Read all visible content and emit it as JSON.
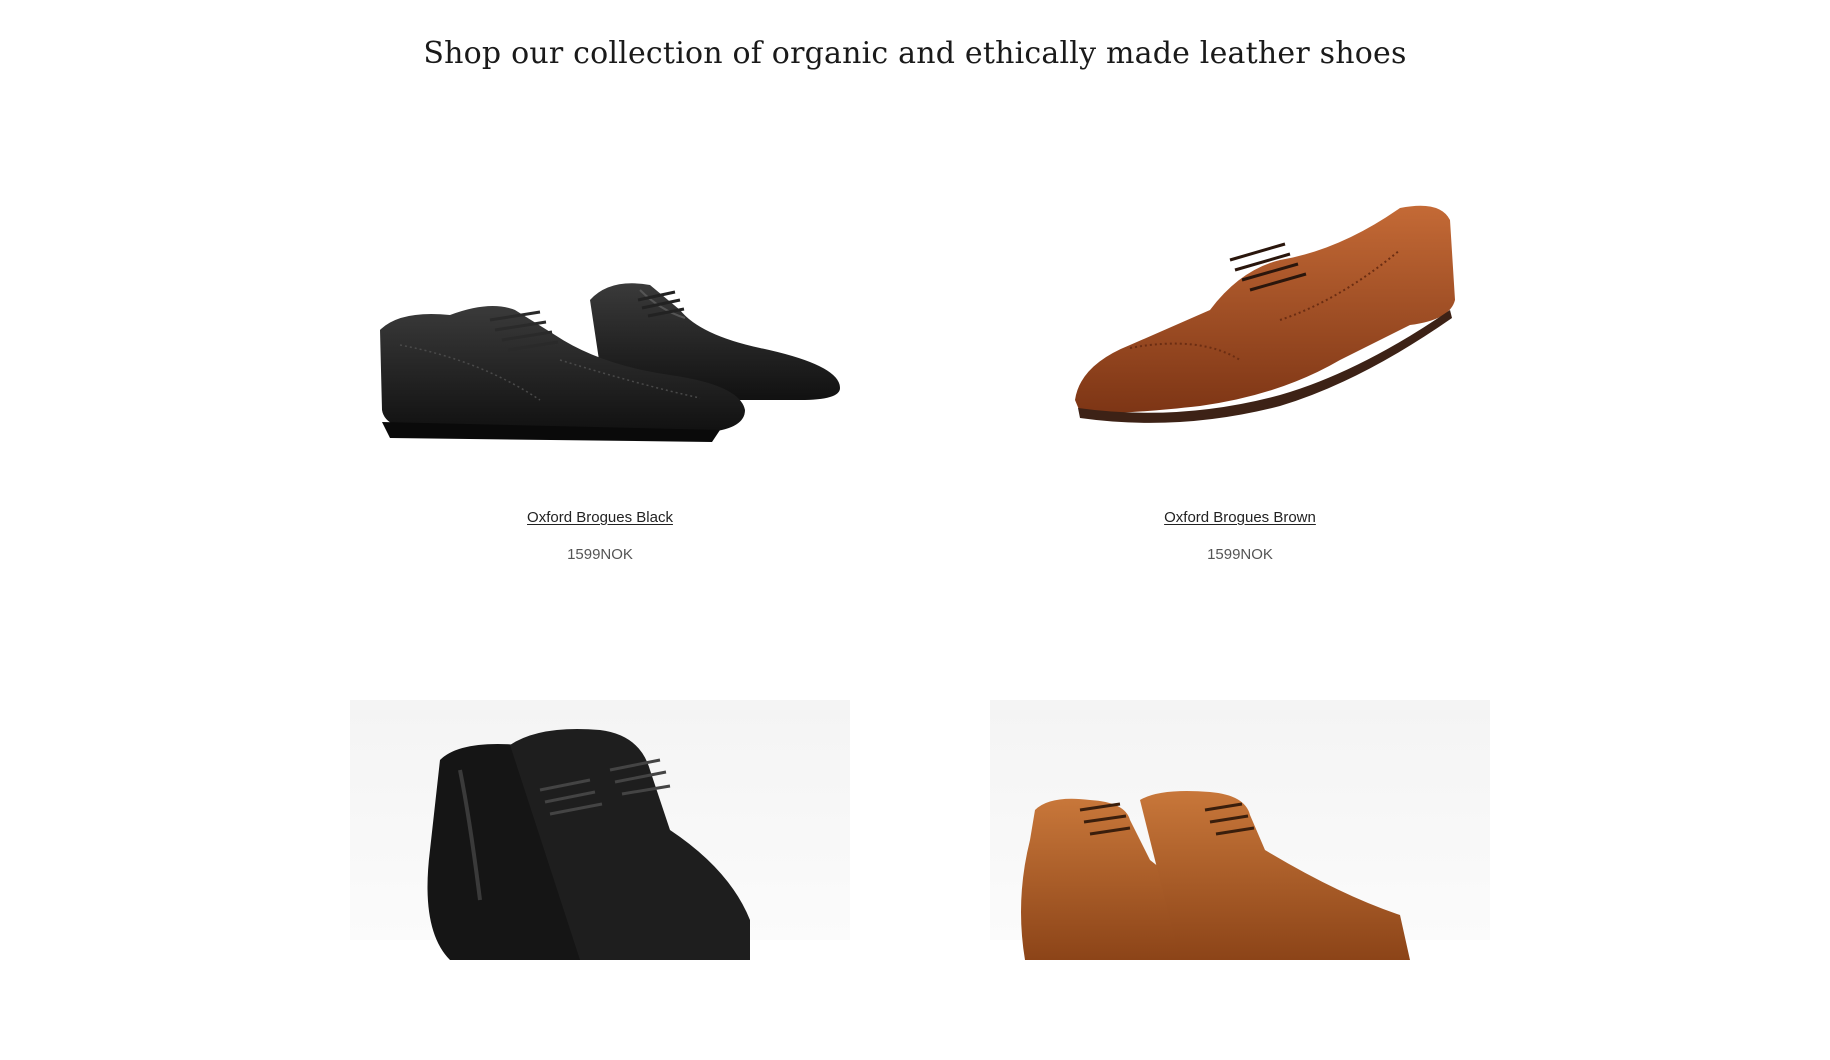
{
  "page": {
    "title": "Shop our collection of organic and ethically made leather shoes"
  },
  "products": [
    {
      "name": "Oxford Brogues Black",
      "price": "1599NOK",
      "image": "black-brogue-shoe",
      "color": "#1c1c1c"
    },
    {
      "name": "Oxford Brogues Brown",
      "price": "1599NOK",
      "image": "brown-brogue-shoe",
      "color": "#a2522a"
    },
    {
      "image": "black-chukka-boot",
      "color": "#141414"
    },
    {
      "image": "tan-chukka-boot",
      "color": "#b5642c"
    }
  ]
}
